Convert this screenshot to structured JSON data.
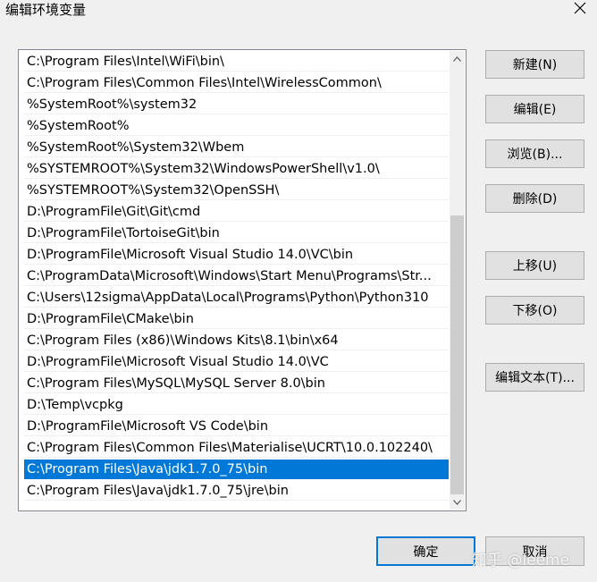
{
  "window": {
    "title": "编辑环境变量"
  },
  "path_list": [
    "C:\\Program Files\\Intel\\WiFi\\bin\\",
    "C:\\Program Files\\Common Files\\Intel\\WirelessCommon\\",
    "%SystemRoot%\\system32",
    "%SystemRoot%",
    "%SystemRoot%\\System32\\Wbem",
    "%SYSTEMROOT%\\System32\\WindowsPowerShell\\v1.0\\",
    "%SYSTEMROOT%\\System32\\OpenSSH\\",
    "D:\\ProgramFile\\Git\\Git\\cmd",
    "D:\\ProgramFile\\TortoiseGit\\bin",
    "D:\\ProgramFile\\Microsoft Visual Studio 14.0\\VC\\bin",
    "C:\\ProgramData\\Microsoft\\Windows\\Start Menu\\Programs\\Str...",
    "C:\\Users\\12sigma\\AppData\\Local\\Programs\\Python\\Python310",
    "D:\\ProgramFile\\CMake\\bin",
    "C:\\Program Files (x86)\\Windows Kits\\8.1\\bin\\x64",
    "D:\\ProgramFile\\Microsoft Visual Studio 14.0\\VC",
    "C:\\Program Files\\MySQL\\MySQL Server 8.0\\bin",
    "D:\\Temp\\vcpkg",
    "D:\\ProgramFile\\Microsoft VS Code\\bin",
    "C:\\Program Files\\Common Files\\Materialise\\UCRT\\10.0.102240\\",
    "C:\\Program Files\\Java\\jdk1.7.0_75\\bin",
    "C:\\Program Files\\Java\\jdk1.7.0_75\\jre\\bin"
  ],
  "selected_index": 19,
  "buttons": {
    "new": "新建(N)",
    "edit": "编辑(E)",
    "browse": "浏览(B)...",
    "delete": "删除(D)",
    "move_up": "上移(U)",
    "move_down": "下移(O)",
    "edit_text": "编辑文本(T)...",
    "ok": "确定",
    "cancel": "取消"
  },
  "watermark": "知乎 @leeme",
  "colors": {
    "selection": "#0078d7",
    "dialog_bg": "#f0f0f0",
    "button_bg": "#e1e1e1"
  },
  "icons": {
    "close": "close-icon",
    "scroll_up": "arrow-up-icon",
    "scroll_down": "arrow-down-icon"
  }
}
